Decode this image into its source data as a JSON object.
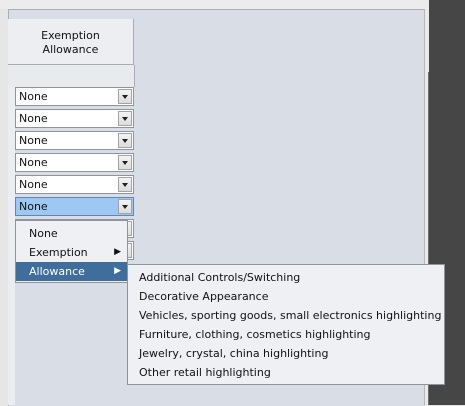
{
  "column_header": "Exemption\nAllowance",
  "rows": [
    "None",
    "None",
    "None",
    "None",
    "None",
    "None"
  ],
  "menu": {
    "items": [
      {
        "label": "None",
        "has_submenu": false
      },
      {
        "label": "Exemption",
        "has_submenu": true
      },
      {
        "label": "Allowance",
        "has_submenu": true
      }
    ]
  },
  "submenu": {
    "items": [
      "Additional Controls/Switching",
      "Decorative Appearance",
      "Vehicles, sporting goods, small electronics highlighting",
      "Furniture, clothing, cosmetics highlighting",
      "Jewelry, crystal, china highlighting",
      "Other retail highlighting"
    ]
  },
  "colors": {
    "selected": "#9ec8f4",
    "menu_active": "#3f6d9c"
  }
}
